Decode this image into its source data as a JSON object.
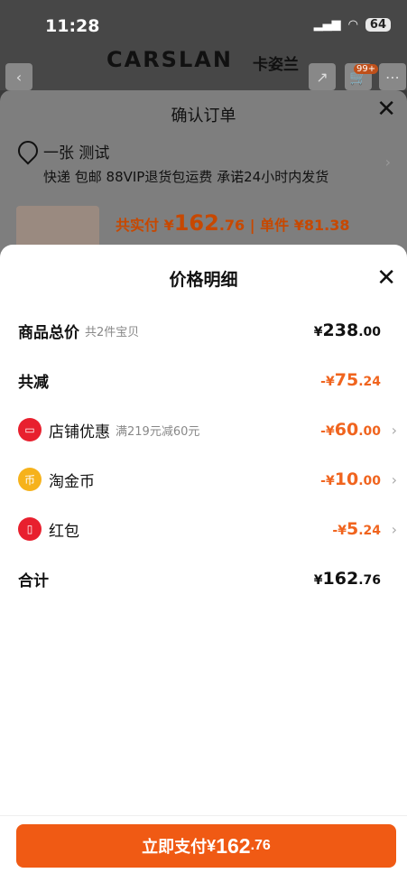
{
  "status": {
    "time": "11:28",
    "battery": "64"
  },
  "brand": {
    "latin": "CARSLAN",
    "cn": "卡姿兰"
  },
  "cart_badge": "99+",
  "confirm": {
    "title": "确认订单",
    "address_name": "一张 测试",
    "address_sub": "快递 包邮 88VIP退货包运费 承诺24小时内发货",
    "total_label": "共实付",
    "total_yen": "¥",
    "total_int": "162",
    "total_dec": ".76",
    "unit_label": "| 单件 ¥81.38"
  },
  "price_detail": {
    "title": "价格明细",
    "rows": [
      {
        "label": "商品总价",
        "note": "共2件宝贝",
        "yen": "¥",
        "int": "238",
        "dec": ".00"
      },
      {
        "label": "共减",
        "note": "",
        "yen": "-¥",
        "int": "75",
        "dec": ".24"
      },
      {
        "label": "店铺优惠",
        "note": "满219元减60元",
        "yen": "-¥",
        "int": "60",
        "dec": ".00"
      },
      {
        "label": "淘金币",
        "note": "",
        "yen": "-¥",
        "int": "10",
        "dec": ".00"
      },
      {
        "label": "红包",
        "note": "",
        "yen": "-¥",
        "int": "5",
        "dec": ".24"
      },
      {
        "label": "合计",
        "note": "",
        "yen": "¥",
        "int": "162",
        "dec": ".76"
      }
    ]
  },
  "pay_button": {
    "label": "立即支付",
    "yen": "¥",
    "int": "162",
    "dec": ".76"
  },
  "icons": {
    "close": "close-icon",
    "chevron": "chevron-right-icon",
    "store": "store-icon",
    "coin": "coin-icon",
    "red_envelope": "red-envelope-icon"
  },
  "colors": {
    "accent": "#f05a14",
    "discount": "#f0641e",
    "text": "#111111"
  }
}
